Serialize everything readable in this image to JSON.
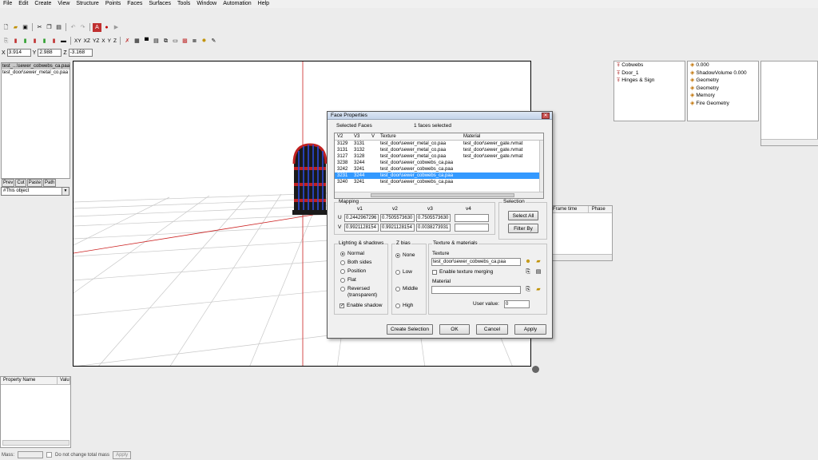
{
  "menu": [
    "File",
    "Edit",
    "Create",
    "View",
    "Structure",
    "Points",
    "Faces",
    "Surfaces",
    "Tools",
    "Window",
    "Automation",
    "Help"
  ],
  "toolbar2": {
    "xy": "XY",
    "xz": "XZ",
    "yz": "YZ",
    "x": "X",
    "y": "Y",
    "z": "Z"
  },
  "coords": {
    "x_label": "X",
    "x": "3.914",
    "y_label": "Y",
    "y": "2.988",
    "z_label": "Z",
    "z": "-3.168"
  },
  "objects": [
    "test_...\\sewer_cobwebs_ca.paa",
    "test_door\\sewer_metal_co.paa"
  ],
  "left_buttons": [
    "Prev",
    "Cut",
    "Paste",
    "Path"
  ],
  "scope_select": "#This object",
  "property_panel": {
    "col_name": "Property Name",
    "col_value": "Valu"
  },
  "status": {
    "mass_label": "Mass:",
    "no_change": "Do not change total mass",
    "apply": "Apply"
  },
  "selections": [
    "Cobwebs",
    "Door_1",
    "Hinges & Sign"
  ],
  "lods": [
    "0.000",
    "ShadowVolume 0.000",
    "Geometry",
    "Geometry",
    "Memory",
    "Fire Geometry"
  ],
  "anim_panel": {
    "col_frame": "Frame time",
    "col_phase": "Phase"
  },
  "dialog": {
    "title": "Face Properties",
    "selected_faces_label": "Selected Faces",
    "count_text": "1 faces selected",
    "columns": [
      "V2",
      "V3",
      "V",
      "Texture",
      "Material"
    ],
    "rows": [
      [
        "3129",
        "3131",
        "",
        "test_door\\sewer_metal_co.paa",
        "test_door\\sewer_gate.rvmat"
      ],
      [
        "3131",
        "3132",
        "",
        "test_door\\sewer_metal_co.paa",
        "test_door\\sewer_gate.rvmat"
      ],
      [
        "3127",
        "3128",
        "",
        "test_door\\sewer_metal_co.paa",
        "test_door\\sewer_gate.rvmat"
      ],
      [
        "3238",
        "3244",
        "",
        "test_door\\sewer_cobwebs_ca.paa",
        ""
      ],
      [
        "3242",
        "3241",
        "",
        "test_door\\sewer_cobwebs_ca.paa",
        ""
      ],
      [
        "3231",
        "3244",
        "",
        "test_door\\sewer_cobwebs_ca.paa",
        ""
      ],
      [
        "3240",
        "3241",
        "",
        "test_door\\sewer_cobwebs_ca.paa",
        ""
      ]
    ],
    "mapping": {
      "label": "Mapping",
      "headers": [
        "v1",
        "v2",
        "v3",
        "v4"
      ],
      "u_label": "U",
      "v_label": "V",
      "u": [
        "0.2442967296",
        "0.7505573630",
        "0.7505573630",
        ""
      ],
      "v": [
        "0.9921128154",
        "0.9921128154",
        "0.0038273931",
        ""
      ]
    },
    "selection_group": {
      "label": "Selection",
      "select_all": "Select All",
      "filter_by": "Filter By"
    },
    "lighting": {
      "label": "Lighting & shadows",
      "options": [
        "Normal",
        "Both sides",
        "Position",
        "Flat",
        "Reversed",
        "(transparent)"
      ],
      "enable_shadow": "Enable shadow"
    },
    "zbias": {
      "label": "Z bias",
      "options": [
        "None",
        "Low",
        "Middle",
        "High"
      ]
    },
    "texmat": {
      "label": "Texture & materials",
      "texture_label": "Texture",
      "texture_value": "test_door\\sewer_cobwebs_ca.paa",
      "merging": "Enable texture merging",
      "material_label": "Material",
      "material_value": "",
      "user_value_label": "User value:",
      "user_value": "0"
    },
    "buttons": {
      "create_selection": "Create Selection",
      "ok": "OK",
      "cancel": "Cancel",
      "apply": "Apply"
    }
  }
}
